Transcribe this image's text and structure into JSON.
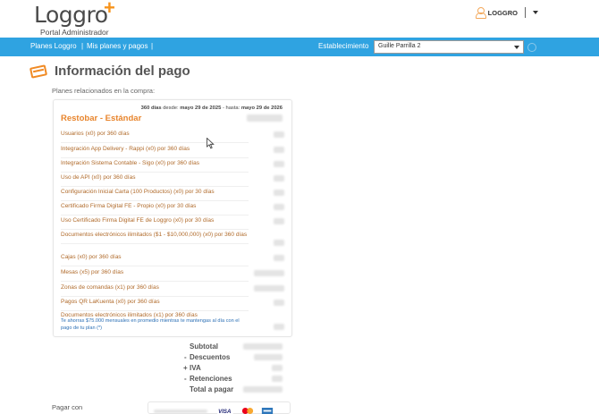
{
  "header": {
    "logo_word": "Loggro",
    "logo_plus": "+",
    "logo_sub": "Portal Administrador",
    "user_label": "LOGGRO"
  },
  "nav": {
    "planes": "Planes Loggro",
    "sep": "|",
    "mis_planes": "Mis planes y pagos",
    "estab_label": "Establecimiento",
    "estab_value": "Guille Parrilla 2"
  },
  "page": {
    "title": "Información del pago",
    "subtitle": "Planes relacionados en la compra:"
  },
  "plan": {
    "period_days": "360 días",
    "period_from_label": "desde:",
    "period_from": "mayo 29 de 2025",
    "period_to_label": "- hasta:",
    "period_to": "mayo 29 de 2026",
    "name": "Restobar - Estándar",
    "items": [
      "Usuarios (x0) por 360 días",
      "Integración App Delivery - Rappi (x0) por 360 días",
      "Integración Sistema Contable - Sigo (x0) por 360 días",
      "Uso de API (x0) por 360 días",
      "Configuración Inicial Carta (100 Productos) (x0) por 30 días",
      "Certificado Firma Digital FE - Propio (x0) por 30 días",
      "Uso Certificado Firma Digital FE de Loggro (x0) por 30 días",
      "Documentos electrónicos ilimitados ($1 - $10,000,000) (x0) por 360 días",
      "Cajas (x0) por 360 días",
      "Mesas (x5) por 360 días",
      "Zonas de comandas (x1) por 360 días",
      "Pagos QR LaKuenta (x0) por 360 días",
      "Documentos electrónicos ilimitados (x1) por 360 días"
    ],
    "note": "Te ahorras $75.000 mensuales en promedio mientras te mantengas al día con el pago de tu plan (*)"
  },
  "totals": {
    "subtotal": "Subtotal",
    "descuentos": "Descuentos",
    "iva": "IVA",
    "retenciones": "Retenciones",
    "total": "Total a pagar",
    "minus": "-",
    "plus": "+"
  },
  "payment": {
    "label": "Pagar con"
  },
  "colors": {
    "navbar": "#2fa3e1",
    "accent": "#e8852d",
    "note": "#2b6fb5"
  }
}
